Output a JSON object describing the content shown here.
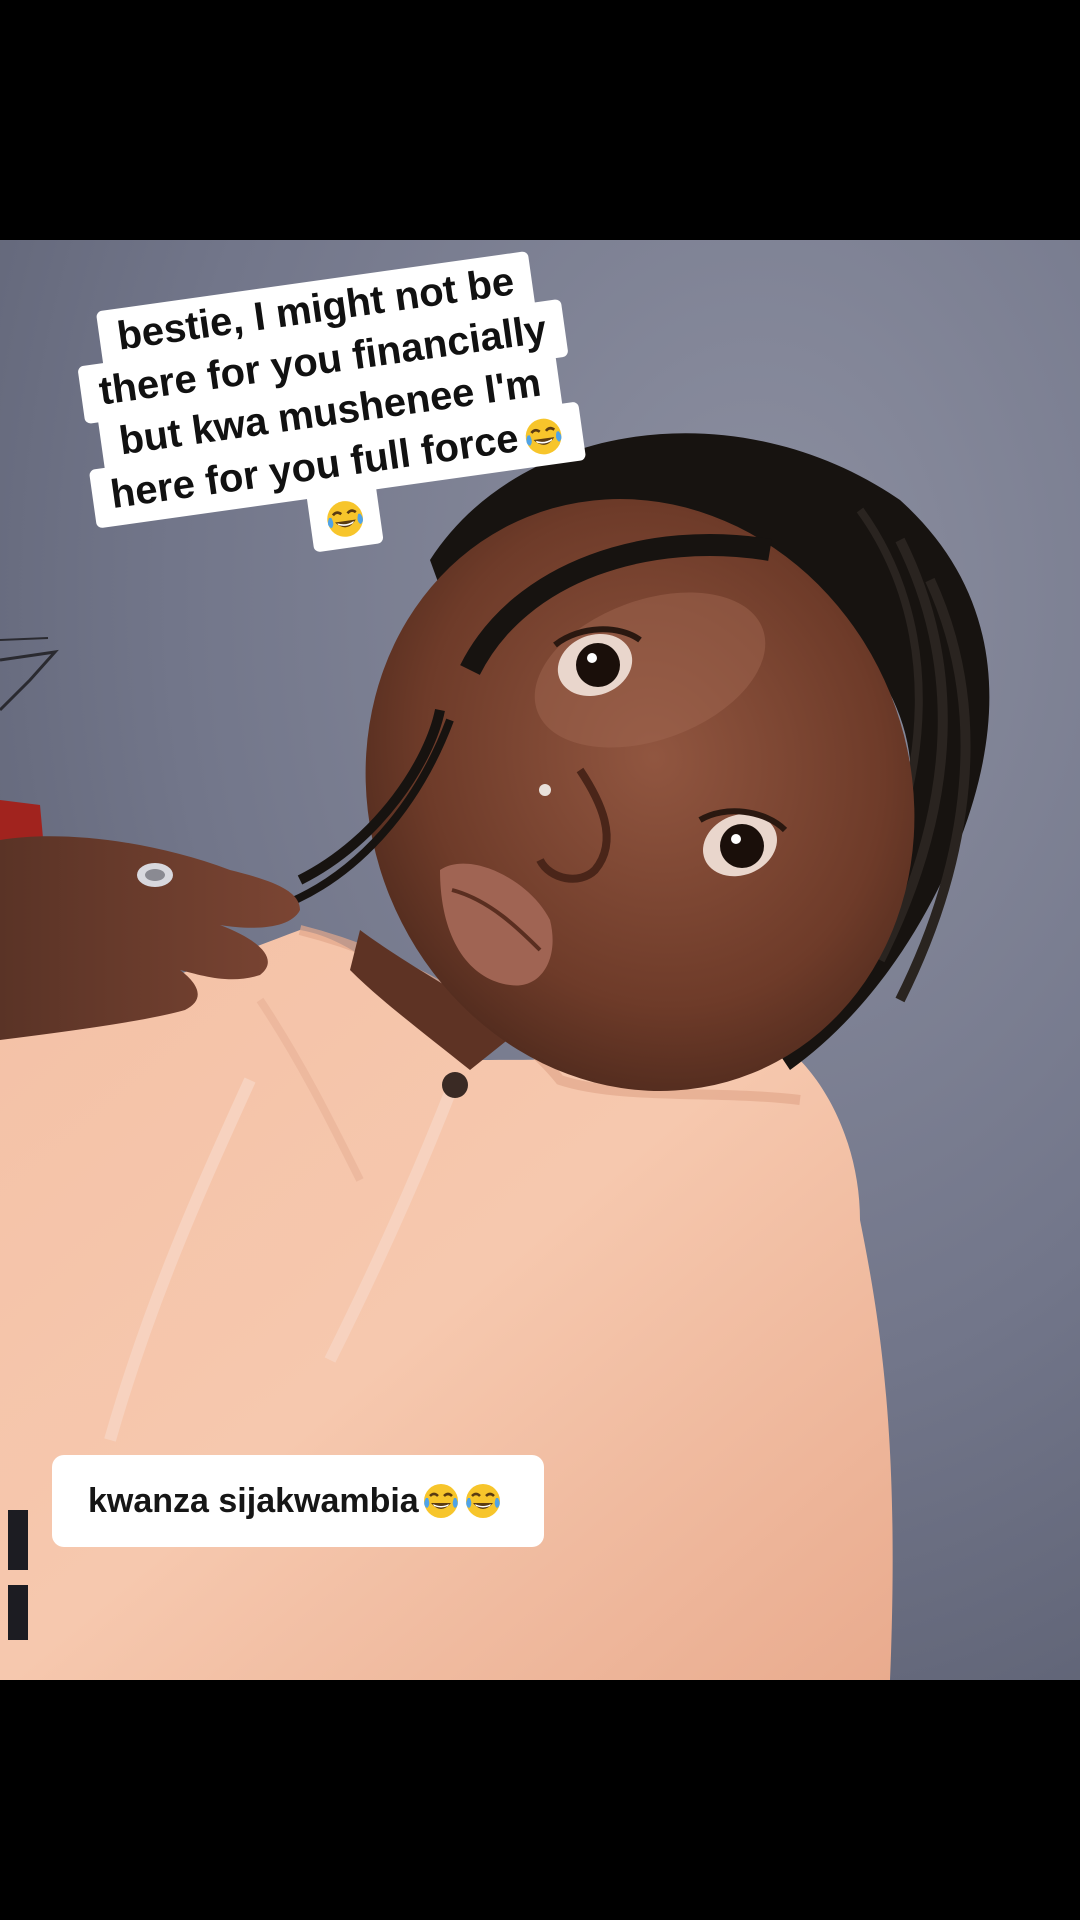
{
  "captions": {
    "top_lines": [
      "bestie, I might not be",
      "there for you financially",
      "but kwa mushenee I'm",
      "here for you full force",
      ""
    ],
    "bottom_text": "kwanza sijakwambia",
    "emoji": "tears-of-joy-emoji"
  },
  "colors": {
    "background": "#000000",
    "wall": "#767a8c",
    "hoodie": "#f2b89c",
    "skin": "#7a4632",
    "hair": "#151210",
    "caption_bg": "#ffffff",
    "caption_text": "#111111"
  }
}
